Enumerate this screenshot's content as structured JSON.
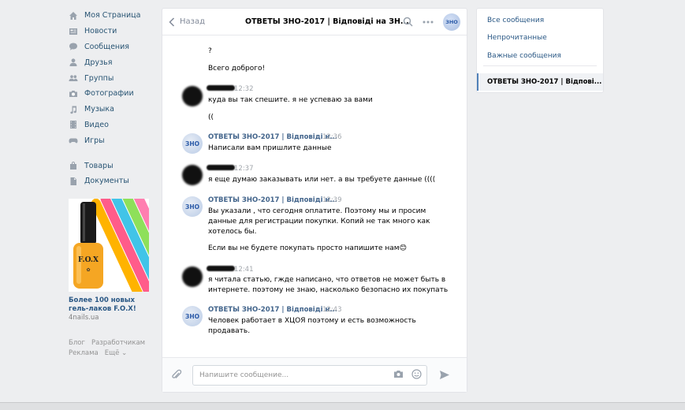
{
  "nav": {
    "items": [
      {
        "label": "Моя Страница",
        "icon": "home-icon"
      },
      {
        "label": "Новости",
        "icon": "news-icon"
      },
      {
        "label": "Сообщения",
        "icon": "messages-icon"
      },
      {
        "label": "Друзья",
        "icon": "friend-icon"
      },
      {
        "label": "Группы",
        "icon": "groups-icon"
      },
      {
        "label": "Фотографии",
        "icon": "camera-icon"
      },
      {
        "label": "Музыка",
        "icon": "music-icon"
      },
      {
        "label": "Видео",
        "icon": "video-icon"
      },
      {
        "label": "Игры",
        "icon": "gamepad-icon"
      }
    ],
    "items2": [
      {
        "label": "Товары",
        "icon": "bag-icon"
      },
      {
        "label": "Документы",
        "icon": "document-icon"
      }
    ]
  },
  "ad": {
    "title": "Более 100 новых гель-лаков F.O.X!",
    "domain": "4nails.ua",
    "bottle_text": "F.O.X"
  },
  "footer": {
    "links": [
      "Блог",
      "Разработчикам",
      "Реклама",
      "Ещё ⌄"
    ]
  },
  "chat": {
    "back_label": "Назад",
    "title": "ОТВЕТЫ ЗНО-2017 | Відповіді на ЗН...",
    "avatar_text": "ЗНО",
    "messages": {
      "m0_line1": "?",
      "m0_line2": "Всего доброго!",
      "m1_time": "12:32",
      "m1_line1": "куда вы так спешите. я не успеваю за вами",
      "m1_line2": "((",
      "m2_author": "ОТВЕТЫ ЗНО-2017 | Відповіді н...",
      "m2_time": "12:36",
      "m2_line1": "Написали вам пришлите данные",
      "m3_time": "12:37",
      "m3_line1": "я еще думаю заказывать или нет. а вы требуете данные ((((",
      "m4_author": "ОТВЕТЫ ЗНО-2017 | Відповіді н...",
      "m4_time": "12:39",
      "m4_line1": "Вы указали , что сегодня оплатите. Поэтому мы и просим",
      "m4_line2": "данные для регистрации покупки. Копий не так много как",
      "m4_line3": "хотелось бы.",
      "m4_line4": "Если вы не будете покупать просто напишите нам😊",
      "m5_time": "12:41",
      "m5_line1": "я читала статью, гжде написано, что ответов не может быть в",
      "m5_line2": "интернете. поэтому не знаю, насколько безопасно их покупать",
      "m6_author": "ОТВЕТЫ ЗНО-2017 | Відповіді н...",
      "m6_time": "12:43",
      "m6_line1": "Человек работает в ХЦОЯ поэтому и есть возможность",
      "m6_line2": "продавать."
    },
    "composer": {
      "placeholder": "Напишите сообщение...",
      "value": ""
    }
  },
  "right": {
    "all": "Все сообщения",
    "unread": "Непрочитанные",
    "important": "Важные сообщения",
    "active": "ОТВЕТЫ ЗНО-2017 | Відпові..."
  },
  "colors": {
    "link": "#2a5885",
    "author": "#42648b",
    "icon": "#99a2ad",
    "background": "#edeef0",
    "accent": "#5181b8"
  }
}
